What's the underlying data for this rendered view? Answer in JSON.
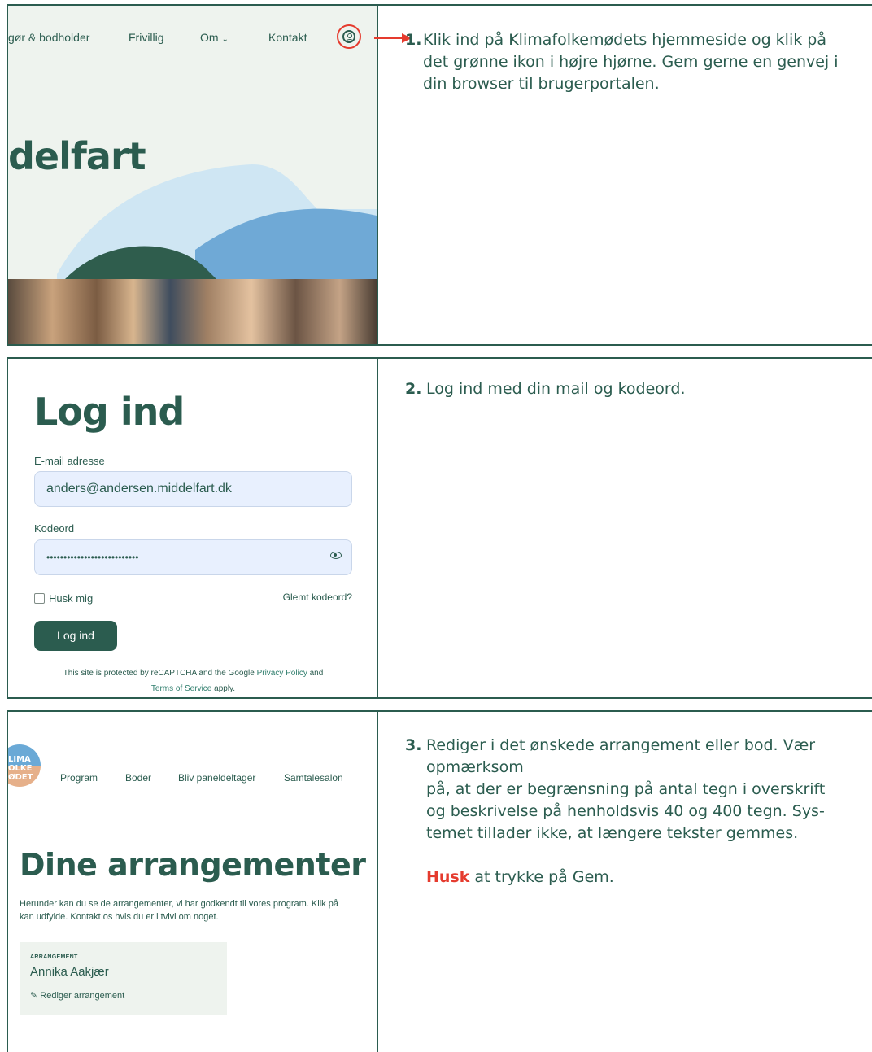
{
  "step1": {
    "nav": [
      "gør & bodholder",
      "Frivillig",
      "Om",
      "Kontakt"
    ],
    "hero": "delfart",
    "number": "1.",
    "text": "Klik ind på Klimafolkemødets hjemmeside og klik på det grønne ikon i højre hjørne. Gem gerne en genvej i din browser til brugerportalen."
  },
  "step2": {
    "title": "Log ind",
    "email_label": "E-mail adresse",
    "email_value": "anders@andersen.middelfart.dk",
    "password_label": "Kodeord",
    "password_value": "•••••••••••••••••••••••••••",
    "remember": "Husk mig",
    "forgot": "Glemt kodeord?",
    "button": "Log ind",
    "recaptcha_1": "This site is protected by reCAPTCHA and the Google ",
    "recaptcha_privacy": "Privacy Policy",
    "recaptcha_and": " and ",
    "recaptcha_terms": "Terms of Service",
    "recaptcha_end": " apply.",
    "number": "2.",
    "text": "Log ind med din mail og kodeord."
  },
  "step3": {
    "logo_lines": [
      "LIMA",
      "OLKE",
      "ØDET"
    ],
    "nav": [
      "Program",
      "Boder",
      "Bliv paneldeltager",
      "Samtalesalon"
    ],
    "title": "Dine arrangementer",
    "desc_1": "Herunder kan du se de arrangementer, vi har godkendt til vores program. Klik på",
    "desc_2": "kan udfylde. Kontakt os hvis du er i tvivl om noget.",
    "card_kind": "ARRANGEMENT",
    "card_name": "Annika Aakjær",
    "card_edit": "Rediger arrangement",
    "number": "3.",
    "text_1": "Rediger i det ønskede arrangement eller bod. Vær opmærksom",
    "text_2": "på, at der er begrænsning på antal tegn i overskrift og beskrivelse på henholdsvis 40 og 400 tegn. Sys-temet tillader ikke, at længere tekster gemmes.",
    "husk": "Husk",
    "husk_rest": " at trykke på Gem."
  },
  "colors": {
    "brand_green": "#2b5c4f",
    "accent_red": "#e53b2e",
    "field_blue": "#e8f0fe"
  }
}
